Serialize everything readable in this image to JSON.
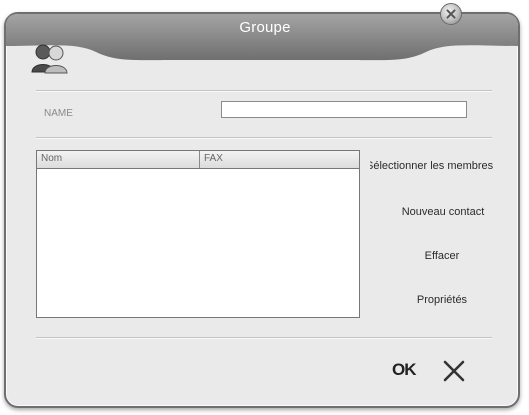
{
  "window": {
    "title": "Groupe"
  },
  "form": {
    "name_label": "NAME",
    "name_value": ""
  },
  "members_table": {
    "columns": [
      {
        "label": "Nom"
      },
      {
        "label": "FAX"
      }
    ],
    "rows": []
  },
  "actions": {
    "select_members": "Sélectionner les membres",
    "new_contact": "Nouveau contact",
    "delete": "Effacer",
    "properties": "Propriétés"
  },
  "footer": {
    "ok_label": "OK",
    "cancel_icon": "close-x-icon"
  },
  "icons": {
    "group": "users-group-icon",
    "window_close": "close-circle-icon"
  },
  "colors": {
    "titlebar": "#8a8a8a",
    "body": "#eaeaea",
    "border": "#6f6f6f"
  }
}
